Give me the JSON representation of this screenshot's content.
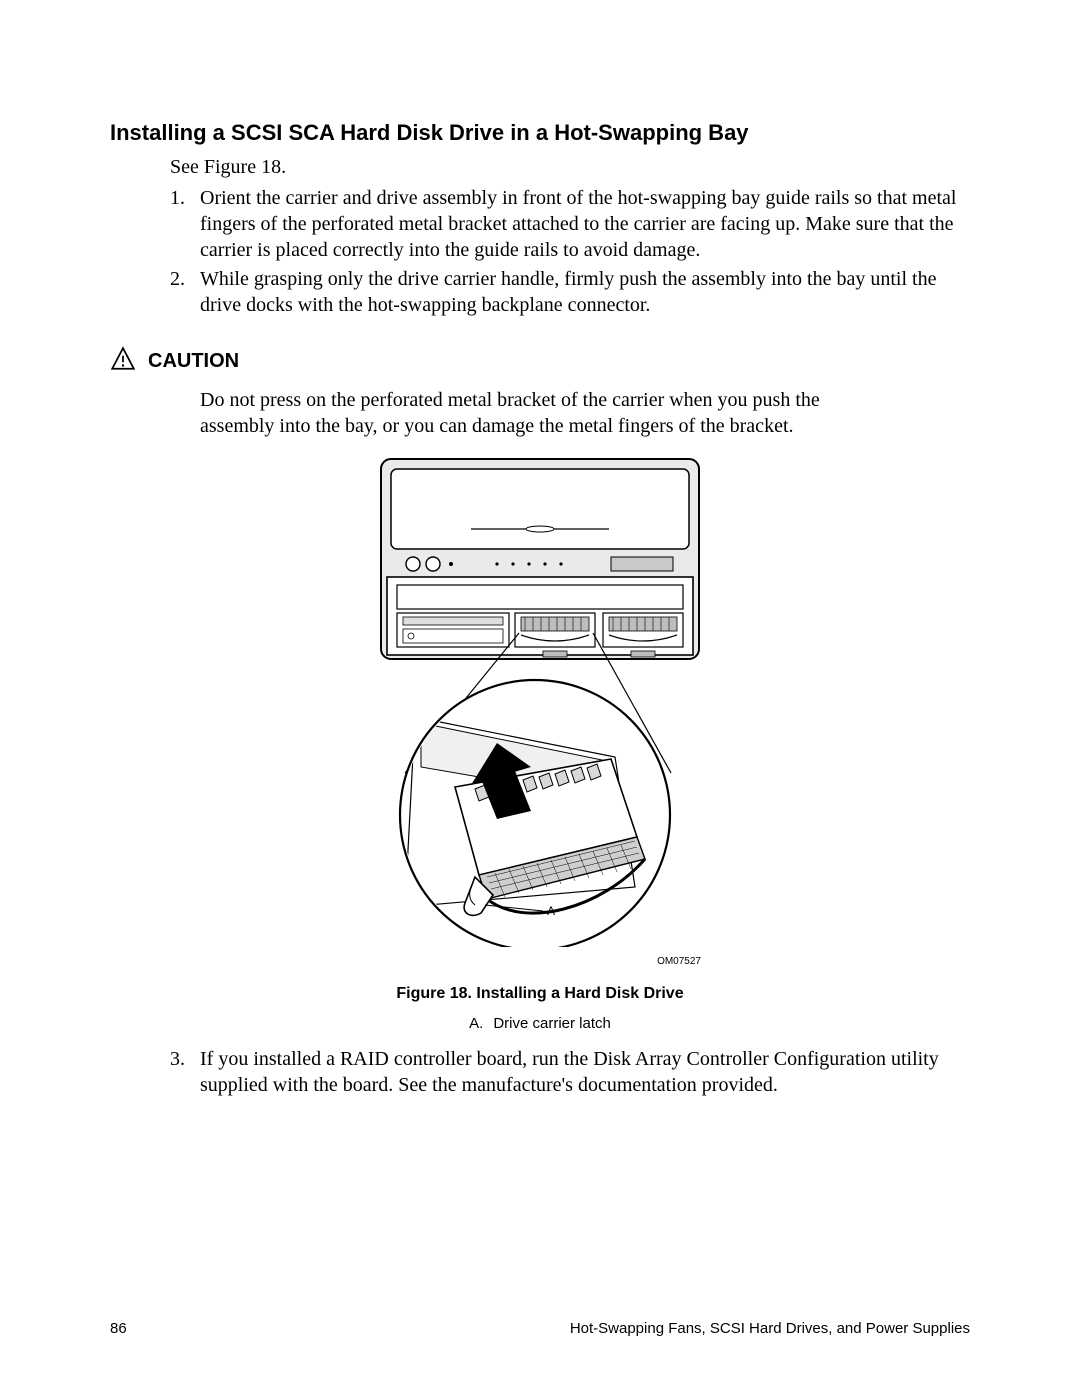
{
  "title": "Installing a SCSI SCA Hard Disk Drive in a Hot-Swapping Bay",
  "intro": "See Figure 18.",
  "steps_top": [
    {
      "num": "1.",
      "text": "Orient the carrier and drive assembly in front of the hot-swapping bay guide rails so that metal fingers of the perforated metal bracket attached to the carrier are facing up.  Make sure that the carrier is placed correctly into the guide rails to avoid damage."
    },
    {
      "num": "2.",
      "text": "While grasping only the drive carrier handle, firmly push the assembly into the bay until the drive docks with the hot-swapping backplane connector."
    }
  ],
  "caution": {
    "label": "CAUTION",
    "body": "Do not press on the perforated metal bracket of the carrier when you push the assembly into the bay, or you can damage the metal fingers of the bracket."
  },
  "figure": {
    "callout_label": "A",
    "ref": "OM07527",
    "caption": "Figure 18.  Installing a Hard Disk Drive",
    "legend_letter": "A.",
    "legend_text": "Drive carrier latch"
  },
  "steps_bottom": [
    {
      "num": "3.",
      "text": "If you installed a RAID controller board, run the Disk Array Controller Configuration utility supplied with the board.  See the manufacture's documentation provided."
    }
  ],
  "footer": {
    "page_number": "86",
    "section": "Hot-Swapping Fans, SCSI Hard Drives, and Power Supplies"
  }
}
